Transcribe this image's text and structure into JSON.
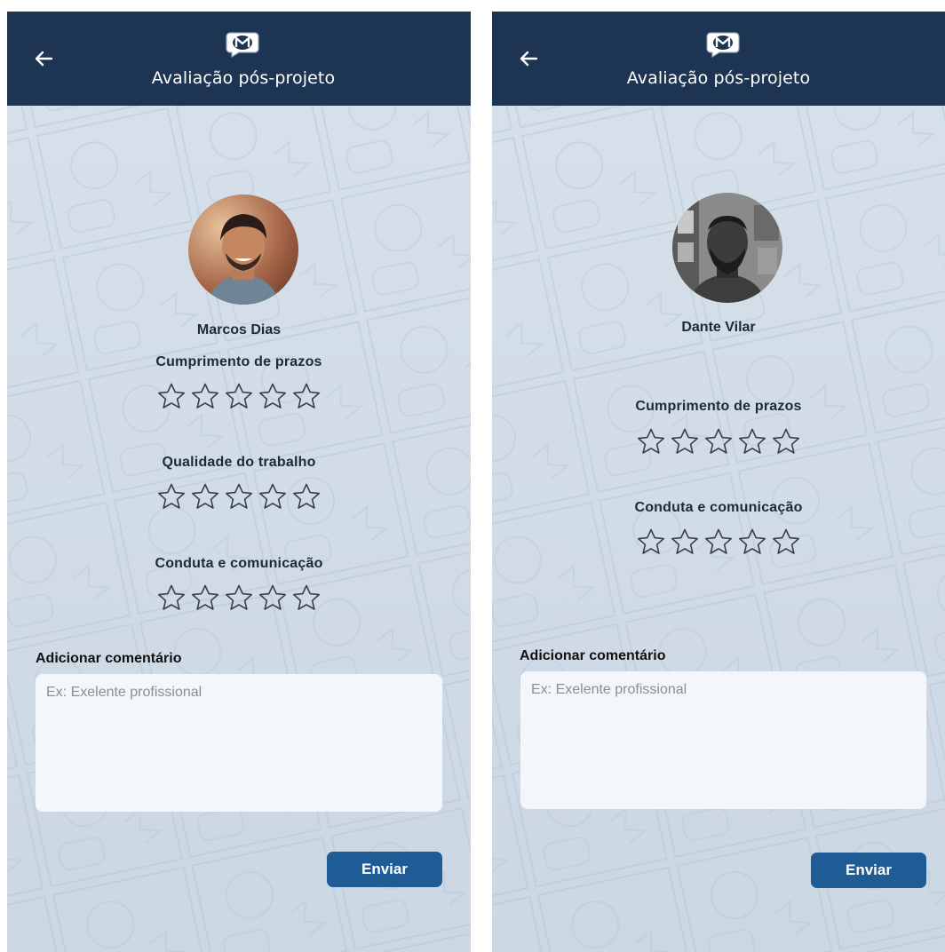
{
  "screens": [
    {
      "header": {
        "title": "Avaliação pós-projeto"
      },
      "person": {
        "name": "Marcos Dias"
      },
      "criteria": [
        {
          "label": "Cumprimento de prazos",
          "rating": 0,
          "max": 5
        },
        {
          "label": "Qualidade do trabalho",
          "rating": 0,
          "max": 5
        },
        {
          "label": "Conduta e comunicação",
          "rating": 0,
          "max": 5
        }
      ],
      "comment": {
        "label": "Adicionar comentário",
        "placeholder": "Ex: Exelente profissional",
        "value": ""
      },
      "submit_label": "Enviar"
    },
    {
      "header": {
        "title": "Avaliação pós-projeto"
      },
      "person": {
        "name": "Dante Vilar"
      },
      "criteria": [
        {
          "label": "Cumprimento de prazos",
          "rating": 0,
          "max": 5
        },
        {
          "label": "Conduta e comunicação",
          "rating": 0,
          "max": 5
        }
      ],
      "comment": {
        "label": "Adicionar comentário",
        "placeholder": "Ex: Exelente profissional",
        "value": ""
      },
      "submit_label": "Enviar"
    }
  ],
  "icons": {
    "back": "arrow-left-icon",
    "logo": "speech-bubble-m-logo",
    "star": "star-outline-icon"
  },
  "colors": {
    "header_bg": "#1d3452",
    "screen_bg": "#d2dde8",
    "button_bg": "#1f5b94",
    "input_bg": "#f3f7fb",
    "text_dark": "#1c2a3a",
    "star_stroke": "#3a3f45"
  }
}
